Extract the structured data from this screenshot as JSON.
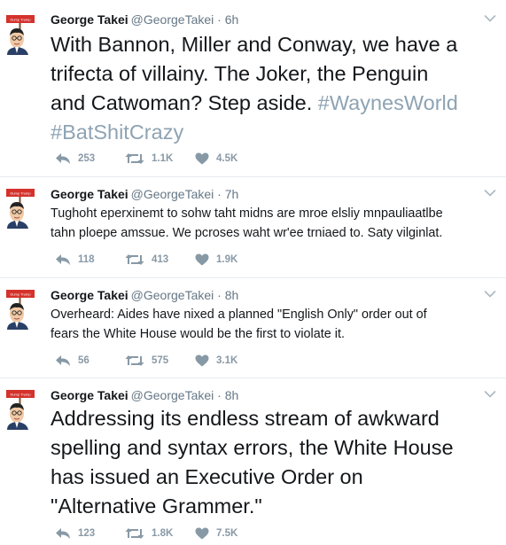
{
  "tweets": [
    {
      "name": "George Takei",
      "handle": "@GeorgeTakei",
      "time": "· 6h",
      "text": "With Bannon, Miller and Conway, we have a\ntrifecta of villainy. The Joker, the Penguin\nand Catwoman? Step aside. ",
      "hashtags": [
        "#WaynesWorld",
        "#BatShitCrazy"
      ],
      "replies": "253",
      "retweets": "1.1K",
      "likes": "4.5K"
    },
    {
      "name": "George Takei",
      "handle": "@GeorgeTakei",
      "time": "· 7h",
      "text": "Tughoht eperxinemt to sohw taht midns are mroe elsliy mnpauliaatlbe\ntahn ploepe amssue. We pcroses waht wr'ee trniaed to. Saty vilginlat.",
      "replies": "118",
      "retweets": "413",
      "likes": "1.9K"
    },
    {
      "name": "George Takei",
      "handle": "@GeorgeTakei",
      "time": "· 8h",
      "text": "Overheard: Aides have nixed a planned \"English Only\" order out of\nfears the White House would be the first to violate it.",
      "replies": "56",
      "retweets": "575",
      "likes": "3.1K"
    },
    {
      "name": "George Takei",
      "handle": "@GeorgeTakei",
      "time": "· 8h",
      "text": "Addressing its endless stream of awkward\nspelling and syntax errors, the White House\nhas issued an Executive Order on\n\"Alternative Grammer.\"",
      "replies": "123",
      "retweets": "1.8K",
      "likes": "7.5K"
    }
  ],
  "avatar_sign_text": "Dump Trump",
  "colors": {
    "name": "#14171a",
    "meta": "#657786",
    "hashtag": "#8ea3b3",
    "action": "#8899a6",
    "sign": "#d4322c"
  },
  "icons": {
    "reply": "reply-icon",
    "retweet": "retweet-icon",
    "like": "heart-icon",
    "menu": "chevron-down-icon"
  }
}
